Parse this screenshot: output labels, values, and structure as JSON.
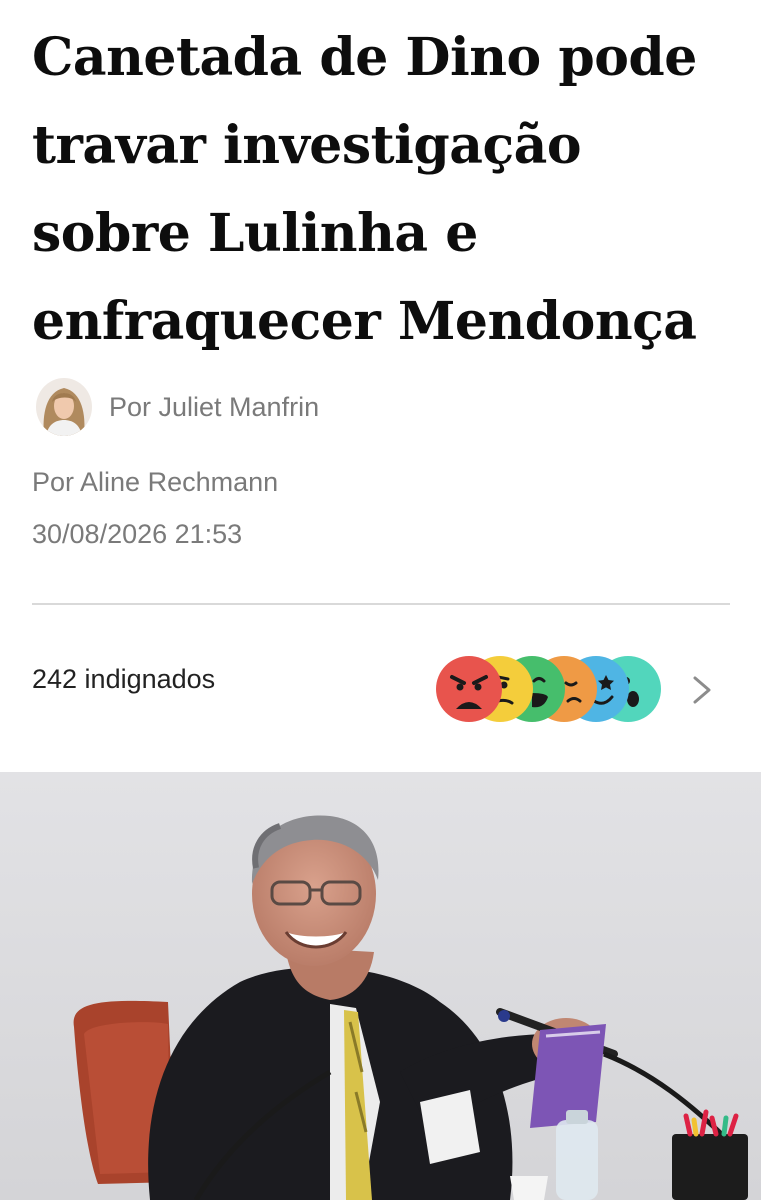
{
  "article": {
    "headline_lines": [
      "Canetada de Dino pode",
      "travar investigação",
      "sobre Lulinha e",
      "enfraquecer Mendonça"
    ],
    "author_name": "Por Juliet Manfrin",
    "byline": "Por Aline Rechmann",
    "timestamp": "30/08/2026 21:53"
  },
  "reactions": {
    "count_label": "242 indignados",
    "emojis": [
      "angry-emoji",
      "skeptical-emoji",
      "laughing-emoji",
      "sad-emoji",
      "starstruck-emoji",
      "surprised-emoji"
    ],
    "colors": {
      "angry": "#e8544d",
      "skeptical": "#f4cd3b",
      "laughing": "#46be6c",
      "sad": "#ef9a45",
      "starstruck": "#4fb5e4",
      "surprised": "#52d6bc"
    }
  },
  "icons": {
    "chevron": "chevron-right-icon"
  }
}
